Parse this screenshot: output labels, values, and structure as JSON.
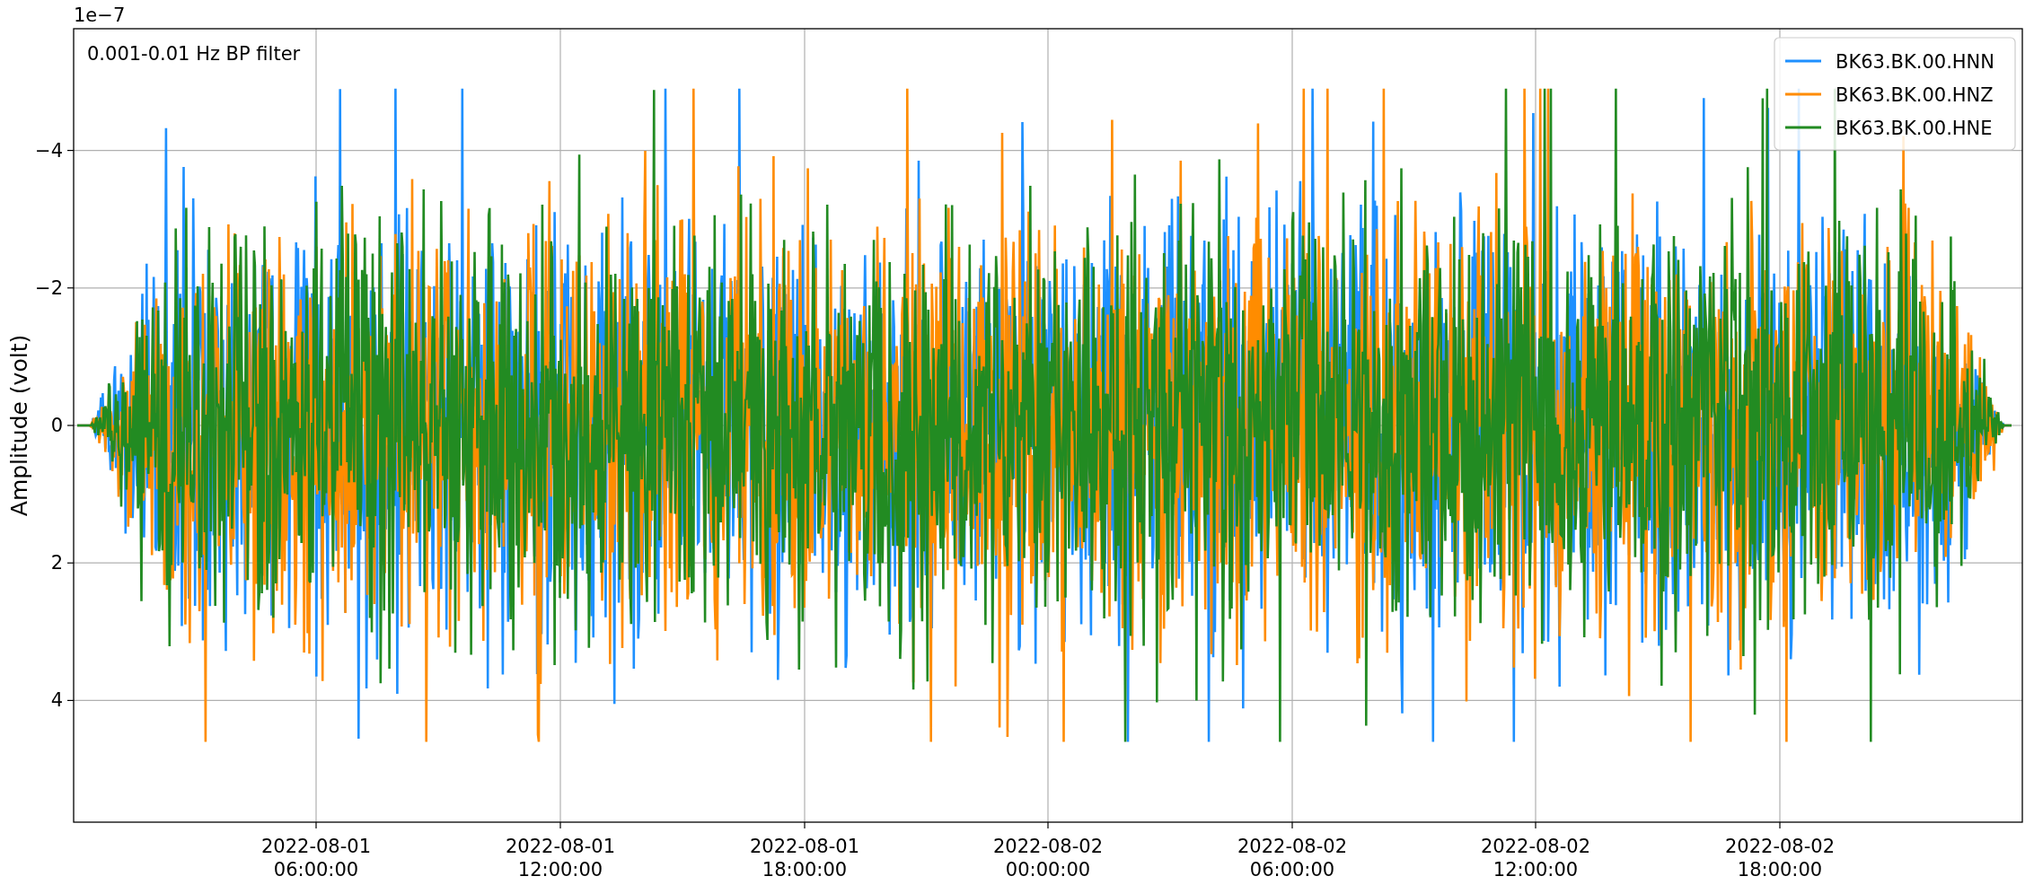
{
  "plot": {
    "offset_label": "1e−7",
    "ylabel": "Amplitude (volt)",
    "annotation": "0.001-0.01 Hz BP filter",
    "yticks": [
      "−4",
      "−2",
      "0",
      "2",
      "4"
    ],
    "xticks": [
      {
        "date": "2022-08-01",
        "time": "06:00:00"
      },
      {
        "date": "2022-08-01",
        "time": "12:00:00"
      },
      {
        "date": "2022-08-01",
        "time": "18:00:00"
      },
      {
        "date": "2022-08-02",
        "time": "00:00:00"
      },
      {
        "date": "2022-08-02",
        "time": "06:00:00"
      },
      {
        "date": "2022-08-02",
        "time": "12:00:00"
      },
      {
        "date": "2022-08-02",
        "time": "18:00:00"
      }
    ],
    "legend": [
      {
        "label": "BK63.BK.00.HNN",
        "color": "#1e90ff"
      },
      {
        "label": "BK63.BK.00.HNZ",
        "color": "#ff8c00"
      },
      {
        "label": "BK63.BK.00.HNE",
        "color": "#228b22"
      }
    ]
  }
}
